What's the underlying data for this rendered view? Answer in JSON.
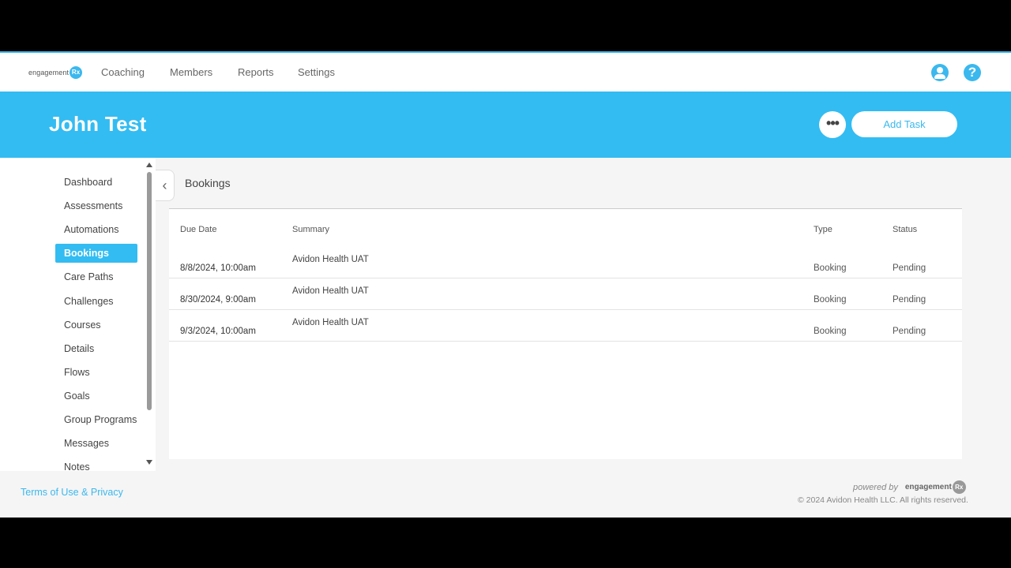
{
  "nav": {
    "logo_text": "engagement",
    "logo_badge": "Rx",
    "links": [
      "Coaching",
      "Members",
      "Reports",
      "Settings"
    ]
  },
  "header": {
    "member_name": "John Test",
    "more_label": "•••",
    "add_task_label": "Add Task"
  },
  "sidebar": {
    "items": [
      {
        "label": "Dashboard",
        "active": false
      },
      {
        "label": "Assessments",
        "active": false
      },
      {
        "label": "Automations",
        "active": false
      },
      {
        "label": "Bookings",
        "active": true
      },
      {
        "label": "Care Paths",
        "active": false
      },
      {
        "label": "Challenges",
        "active": false
      },
      {
        "label": "Courses",
        "active": false
      },
      {
        "label": "Details",
        "active": false
      },
      {
        "label": "Flows",
        "active": false
      },
      {
        "label": "Goals",
        "active": false
      },
      {
        "label": "Group Programs",
        "active": false
      },
      {
        "label": "Messages",
        "active": false
      },
      {
        "label": "Notes",
        "active": false
      }
    ]
  },
  "section": {
    "title": "Bookings"
  },
  "table": {
    "columns": [
      "Due Date",
      "Summary",
      "Type",
      "Status"
    ],
    "rows": [
      {
        "due_date": "8/8/2024, 10:00am",
        "summary": "Avidon Health UAT",
        "type": "Booking",
        "status": "Pending"
      },
      {
        "due_date": "8/30/2024, 9:00am",
        "summary": "Avidon Health UAT",
        "type": "Booking",
        "status": "Pending"
      },
      {
        "due_date": "9/3/2024, 10:00am",
        "summary": "Avidon Health UAT",
        "type": "Booking",
        "status": "Pending"
      }
    ]
  },
  "footer": {
    "terms": "Terms of Use & Privacy",
    "powered_by": "powered by",
    "powered_logo": "engagement",
    "powered_badge": "Rx",
    "copyright": "© 2024 Avidon Health LLC. All rights reserved."
  },
  "colors": {
    "accent": "#33bcf2",
    "link": "#3bb8ee"
  }
}
